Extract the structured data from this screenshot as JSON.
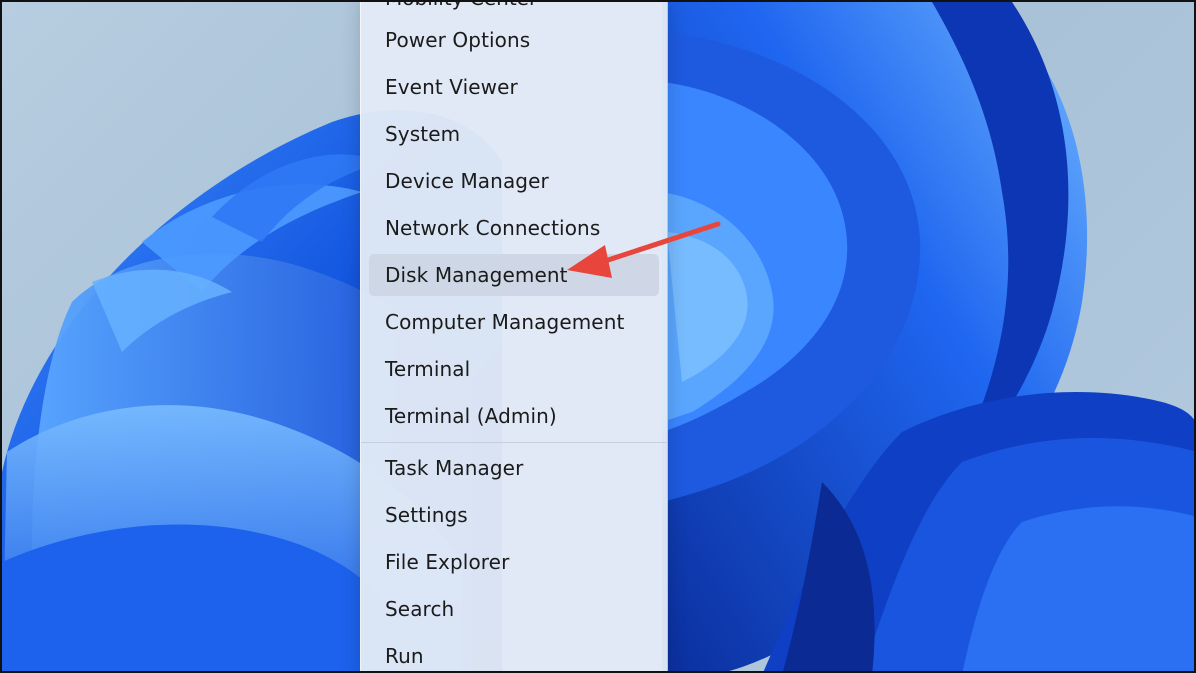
{
  "menu": {
    "clipped_top_label": "Mobility Center",
    "items": [
      {
        "label": "Power Options"
      },
      {
        "label": "Event Viewer"
      },
      {
        "label": "System"
      },
      {
        "label": "Device Manager"
      },
      {
        "label": "Network Connections"
      },
      {
        "label": "Disk Management"
      },
      {
        "label": "Computer Management"
      },
      {
        "label": "Terminal"
      },
      {
        "label": "Terminal (Admin)"
      },
      {
        "label": "Task Manager"
      },
      {
        "label": "Settings"
      },
      {
        "label": "File Explorer"
      },
      {
        "label": "Search"
      },
      {
        "label": "Run"
      }
    ]
  },
  "annotation": {
    "arrow_color": "#e8453c",
    "points_to": "Disk Management"
  },
  "colors": {
    "wallpaper_bloom": "#1a5ce8",
    "menu_background": "#e2eaf6",
    "hover_highlight": "#cdd6e5"
  }
}
